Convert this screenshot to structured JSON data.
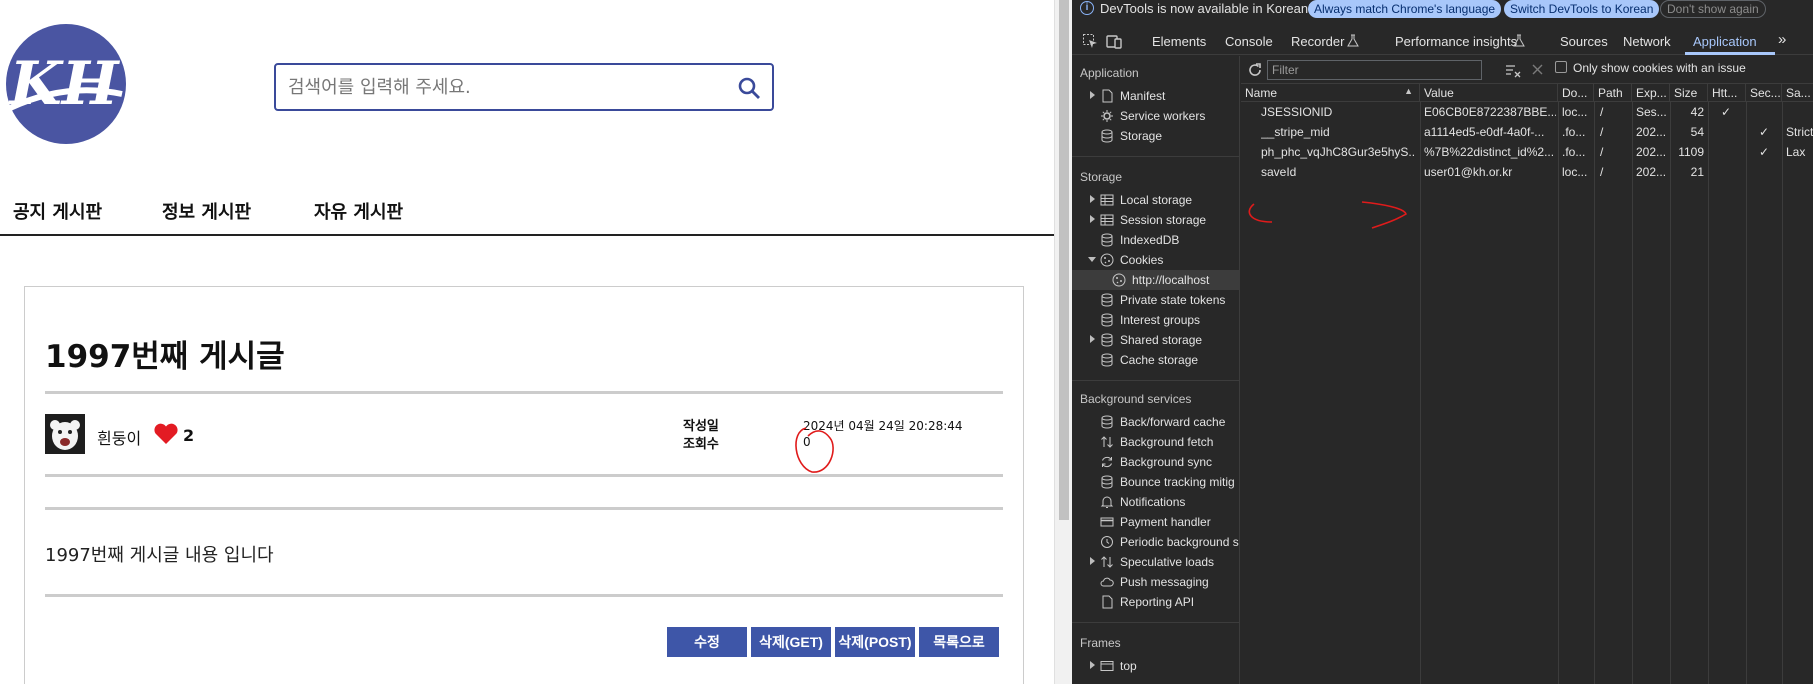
{
  "site": {
    "logo_text": "KH",
    "search": {
      "placeholder": "검색어를 입력해 주세요.",
      "value": ""
    },
    "nav": [
      "공지 게시판",
      "정보 게시판",
      "자유 게시판"
    ]
  },
  "post": {
    "title": "1997번째 게시글",
    "writer": "흰둥이",
    "like_count": "2",
    "created_label": "작성일",
    "created_value": "2024년 04월 24일 20:28:44",
    "views_label": "조회수",
    "views_value": "0",
    "content": "1997번째 게시글 내용 입니다",
    "buttons": [
      "수정",
      "삭제(GET)",
      "삭제(POST)",
      "목록으로"
    ]
  },
  "devtools": {
    "infobar": {
      "message": "DevTools is now available in Korean!",
      "actions": [
        "Always match Chrome's language",
        "Switch DevTools to Korean",
        "Don't show again"
      ]
    },
    "tabs": [
      "Elements",
      "Console",
      "Recorder",
      "Performance insights",
      "Sources",
      "Network",
      "Application"
    ],
    "active_tab": "Application",
    "filter_placeholder": "Filter",
    "only_issue_label": "Only show cookies with an issue",
    "sidebar": {
      "application_title": "Application",
      "application_items": [
        "Manifest",
        "Service workers",
        "Storage"
      ],
      "storage_title": "Storage",
      "storage_items": [
        "Local storage",
        "Session storage",
        "IndexedDB",
        "Cookies",
        "http://localhost",
        "Private state tokens",
        "Interest groups",
        "Shared storage",
        "Cache storage"
      ],
      "background_title": "Background services",
      "background_items": [
        "Back/forward cache",
        "Background fetch",
        "Background sync",
        "Bounce tracking mitig",
        "Notifications",
        "Payment handler",
        "Periodic background s",
        "Speculative loads",
        "Push messaging",
        "Reporting API"
      ],
      "frames_title": "Frames",
      "frames_items": [
        "top"
      ]
    },
    "cookie_columns": [
      "Name",
      "Value",
      "Do...",
      "Path",
      "Exp...",
      "Size",
      "Htt...",
      "Sec...",
      "Sa..."
    ],
    "cookies": [
      {
        "name": "JSESSIONID",
        "value": "E06CB0E8722387BBE...",
        "domain": "loc...",
        "path": "/",
        "expires": "Ses...",
        "size": "42",
        "httponly": "✓",
        "secure": "",
        "samesite": ""
      },
      {
        "name": "__stripe_mid",
        "value": "a1114ed5-e0df-4a0f-...",
        "domain": ".fo...",
        "path": "/",
        "expires": "202...",
        "size": "54",
        "httponly": "",
        "secure": "✓",
        "samesite": "Strict"
      },
      {
        "name": "ph_phc_vqJhC8Gur3e5hyS...",
        "value": "%7B%22distinct_id%2...",
        "domain": ".fo...",
        "path": "/",
        "expires": "202...",
        "size": "1109",
        "httponly": "",
        "secure": "✓",
        "samesite": "Lax"
      },
      {
        "name": "saveId",
        "value": "user01@kh.or.kr",
        "domain": "loc...",
        "path": "/",
        "expires": "202...",
        "size": "21",
        "httponly": "",
        "secure": "",
        "samesite": ""
      }
    ]
  },
  "colors": {
    "accent": "#3e56a8",
    "logo": "#4a55a2",
    "heart": "#e31b23",
    "annotation": "#e01b1b",
    "devtools_bg": "#282828",
    "devtools_accent": "#a8c7fa"
  }
}
